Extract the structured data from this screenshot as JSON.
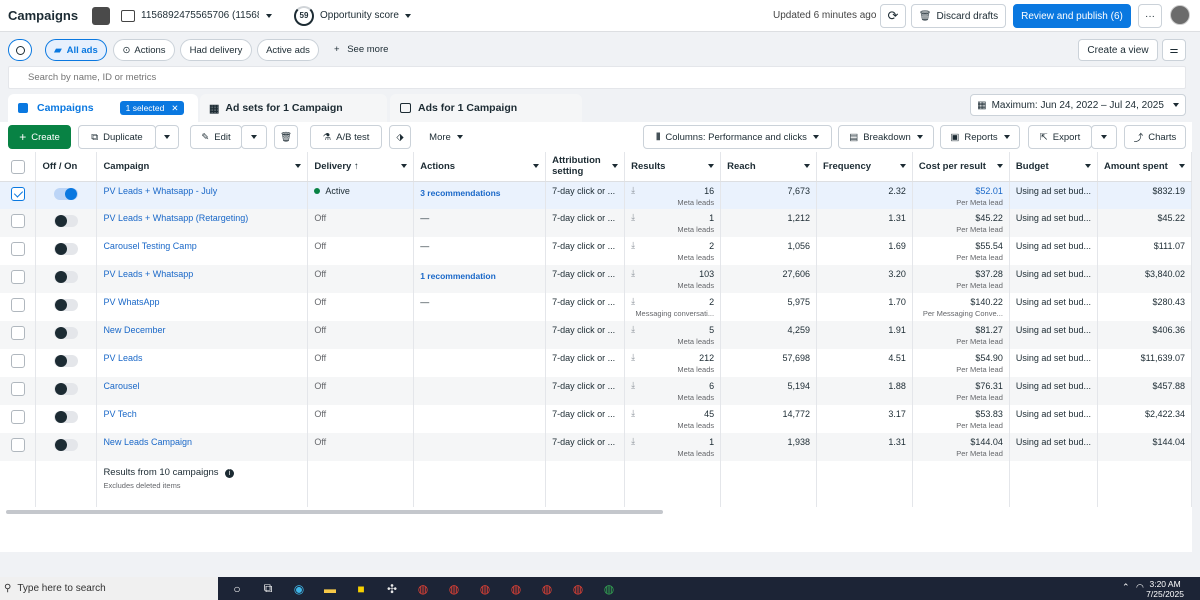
{
  "header": {
    "title": "Campaigns",
    "account_label": "1156892475565706 (11568...",
    "score_value": "59",
    "score_label": "Opportunity score",
    "updated": "Updated 6 minutes ago",
    "discard_label": "Discard drafts",
    "publish_label": "Review and publish (6)",
    "more_label": "···"
  },
  "filters": {
    "all_ads": "All ads",
    "actions": "Actions",
    "had_delivery": "Had delivery",
    "active_ads": "Active ads",
    "see_more": "See more",
    "create_view": "Create a view"
  },
  "search": {
    "placeholder": "Search by name, ID or metrics"
  },
  "tabs": {
    "campaigns": "Campaigns",
    "selected_badge": "1 selected",
    "adsets": "Ad sets for 1 Campaign",
    "ads": "Ads for 1 Campaign",
    "date_range": "Maximum: Jun 24, 2022 – Jul 24, 2025"
  },
  "toolbar": {
    "create": "Create",
    "duplicate": "Duplicate",
    "edit": "Edit",
    "ab_test": "A/B test",
    "more": "More",
    "columns": "Columns: Performance and clicks",
    "breakdown": "Breakdown",
    "reports": "Reports",
    "export": "Export",
    "charts": "Charts"
  },
  "columns": {
    "off_on": "Off / On",
    "campaign": "Campaign",
    "delivery": "Delivery ↑",
    "actions": "Actions",
    "attribution": "Attribution setting",
    "results": "Results",
    "reach": "Reach",
    "frequency": "Frequency",
    "cpr": "Cost per result",
    "budget": "Budget",
    "amount_spent": "Amount spent"
  },
  "rows": [
    {
      "name": "PV Leads + Whatsapp - July",
      "delivery": "Active",
      "actions": "3 recommendations",
      "attribution": "7-day click or ...",
      "results": "16",
      "results_sub": "Meta leads",
      "reach": "7,673",
      "frequency": "2.32",
      "cpr": "$52.01",
      "cpr_sub": "Per Meta lead",
      "budget": "Using ad set bud...",
      "spent": "$832.19"
    },
    {
      "name": "PV Leads + Whatsapp (Retargeting)",
      "delivery": "Off",
      "actions": "—",
      "attribution": "7-day click or ...",
      "results": "1",
      "results_sub": "Meta leads",
      "reach": "1,212",
      "frequency": "1.31",
      "cpr": "$45.22",
      "cpr_sub": "Per Meta lead",
      "budget": "Using ad set bud...",
      "spent": "$45.22"
    },
    {
      "name": "Carousel Testing Camp",
      "delivery": "Off",
      "actions": "—",
      "attribution": "7-day click or ...",
      "results": "2",
      "results_sub": "Meta leads",
      "reach": "1,056",
      "frequency": "1.69",
      "cpr": "$55.54",
      "cpr_sub": "Per Meta lead",
      "budget": "Using ad set bud...",
      "spent": "$111.07"
    },
    {
      "name": "PV Leads + Whatsapp",
      "delivery": "Off",
      "actions": "1 recommendation",
      "attribution": "7-day click or ...",
      "results": "103",
      "results_sub": "Meta leads",
      "reach": "27,606",
      "frequency": "3.20",
      "cpr": "$37.28",
      "cpr_sub": "Per Meta lead",
      "budget": "Using ad set bud...",
      "spent": "$3,840.02"
    },
    {
      "name": "PV WhatsApp",
      "delivery": "Off",
      "actions": "—",
      "attribution": "7-day click or ...",
      "results": "2",
      "results_sub": "Messaging conversati...",
      "reach": "5,975",
      "frequency": "1.70",
      "cpr": "$140.22",
      "cpr_sub": "Per Messaging Conve...",
      "budget": "Using ad set bud...",
      "spent": "$280.43"
    },
    {
      "name": "New December",
      "delivery": "Off",
      "actions": "",
      "attribution": "7-day click or ...",
      "results": "5",
      "results_sub": "Meta leads",
      "reach": "4,259",
      "frequency": "1.91",
      "cpr": "$81.27",
      "cpr_sub": "Per Meta lead",
      "budget": "Using ad set bud...",
      "spent": "$406.36"
    },
    {
      "name": "PV Leads",
      "delivery": "Off",
      "actions": "",
      "attribution": "7-day click or ...",
      "results": "212",
      "results_sub": "Meta leads",
      "reach": "57,698",
      "frequency": "4.51",
      "cpr": "$54.90",
      "cpr_sub": "Per Meta lead",
      "budget": "Using ad set bud...",
      "spent": "$11,639.07"
    },
    {
      "name": "Carousel",
      "delivery": "Off",
      "actions": "",
      "attribution": "7-day click or ...",
      "results": "6",
      "results_sub": "Meta leads",
      "reach": "5,194",
      "frequency": "1.88",
      "cpr": "$76.31",
      "cpr_sub": "Per Meta lead",
      "budget": "Using ad set bud...",
      "spent": "$457.88"
    },
    {
      "name": "PV Tech",
      "delivery": "Off",
      "actions": "",
      "attribution": "7-day click or ...",
      "results": "45",
      "results_sub": "Meta leads",
      "reach": "14,772",
      "frequency": "3.17",
      "cpr": "$53.83",
      "cpr_sub": "Per Meta lead",
      "budget": "Using ad set bud...",
      "spent": "$2,422.34"
    },
    {
      "name": "New Leads Campaign",
      "delivery": "Off",
      "actions": "",
      "attribution": "7-day click or ...",
      "results": "1",
      "results_sub": "Meta leads",
      "reach": "1,938",
      "frequency": "1.31",
      "cpr": "$144.04",
      "cpr_sub": "Per Meta lead",
      "budget": "Using ad set bud...",
      "spent": "$144.04"
    }
  ],
  "summary": {
    "title": "Results from 10 campaigns",
    "sub": "Excludes deleted items"
  },
  "taskbar": {
    "search": "Type here to search",
    "time": "3:20 AM",
    "date": "7/25/2025"
  },
  "colors": {
    "primary": "#0a78e0",
    "create_green": "#088244",
    "active_dot": "#088244"
  }
}
